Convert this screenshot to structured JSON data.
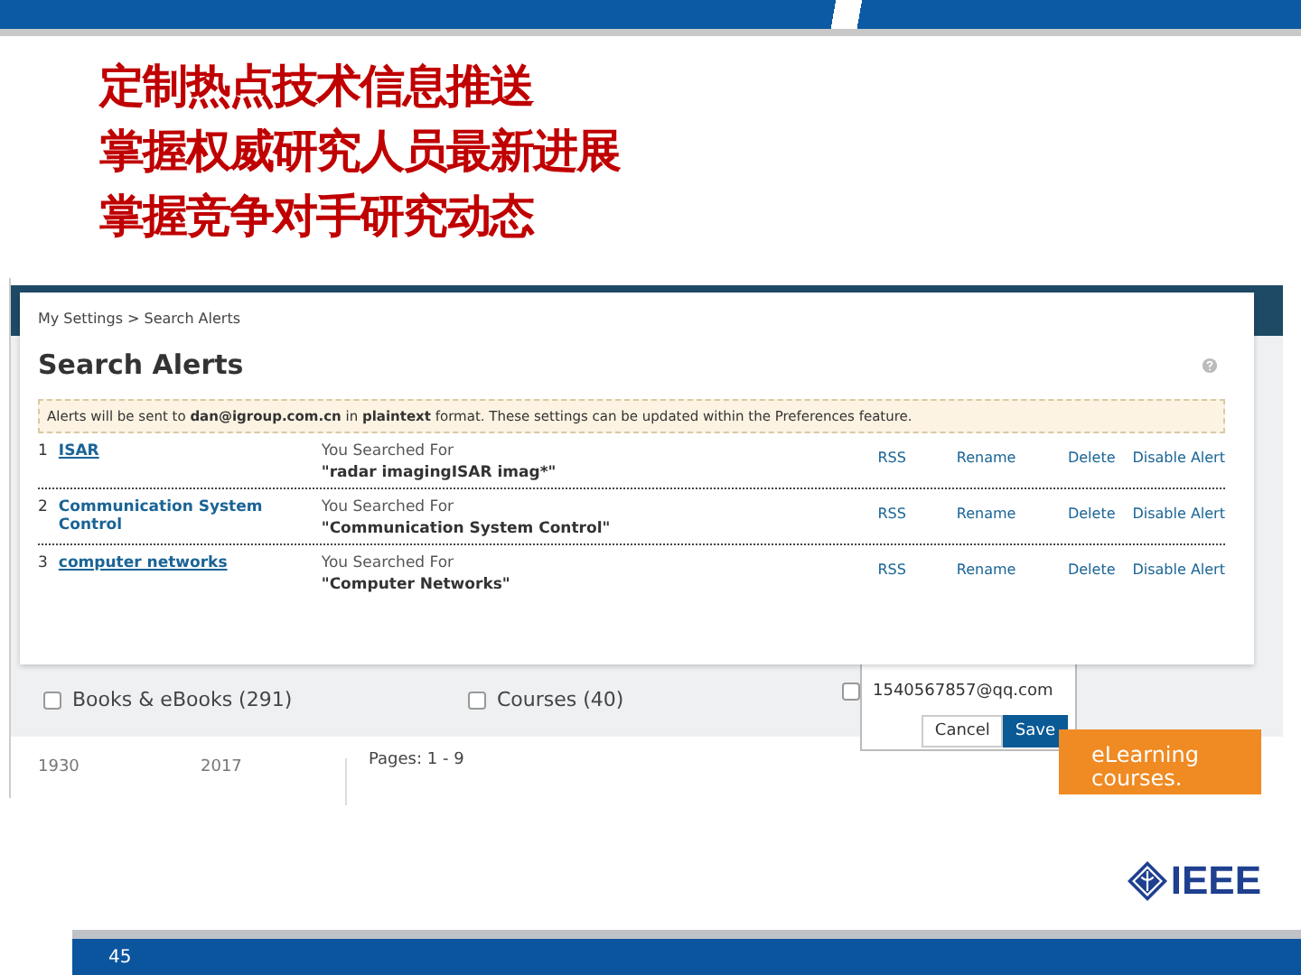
{
  "slide": {
    "headlines": [
      "定制热点技术信息推送",
      "掌握权威研究人员最新进展",
      "掌握竞争对手研究动态"
    ],
    "page_number": "45",
    "logo": "IEEE"
  },
  "screenshot": {
    "background": {
      "filters": [
        {
          "label": "Books & eBooks (291)",
          "checked": false
        },
        {
          "label": "Courses (40)",
          "checked": false
        }
      ],
      "email_option": {
        "checked": false,
        "email": "1540567857@qq.com",
        "buttons": [
          {
            "label": "Cancel",
            "kind": "secondary"
          },
          {
            "label": "Save",
            "kind": "primary"
          }
        ]
      },
      "year_from": "1930",
      "year_to": "2017",
      "pages": "Pages: 1 - 9",
      "promo": "eLearning courses."
    },
    "dialog": {
      "breadcrumb": "My Settings > Search Alerts",
      "title": "Search Alerts",
      "notice": "Alerts will be sent to **dan@igroup.com.cn** in **plaintext** format. These settings can be updated within the Preferences feature.",
      "alerts": [
        {
          "number": "1",
          "name": "ISAR",
          "underlined": true,
          "query_label": "You Searched For",
          "query": "\"radar imagingISAR imag*\"",
          "actions": [
            "RSS",
            "Rename",
            "Delete",
            "Disable Alert"
          ]
        },
        {
          "number": "2",
          "name": "Communication System Control",
          "underlined": false,
          "query_label": "You Searched For",
          "query": "\"Communication System Control\"",
          "actions": [
            "RSS",
            "Rename",
            "Delete",
            "Disable Alert"
          ]
        },
        {
          "number": "3",
          "name": "computer networks",
          "underlined": true,
          "query_label": "You Searched For",
          "query": "\"Computer Networks\"",
          "actions": [
            "RSS",
            "Rename",
            "Delete",
            "Disable Alert"
          ]
        }
      ]
    }
  }
}
